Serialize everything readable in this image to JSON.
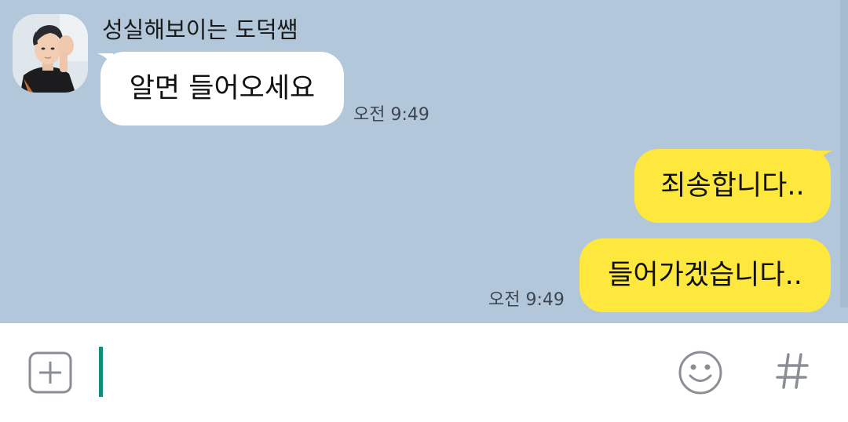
{
  "chat": {
    "sender_name": "성실해보이는 도덕쌤",
    "messages": [
      {
        "direction": "incoming",
        "text": "알면 들어오세요",
        "time": "오전 9:49"
      },
      {
        "direction": "outgoing",
        "text": "죄송합니다..",
        "time": ""
      },
      {
        "direction": "outgoing",
        "text": "들어가겠습니다..",
        "time": "오전 9:49"
      }
    ]
  },
  "composer": {
    "value": "",
    "placeholder": ""
  },
  "icons": {
    "attach": "plus-square-icon",
    "emoji": "smiley-icon",
    "hashtag": "hash-icon"
  },
  "colors": {
    "chat_background": "#b2c7d9",
    "incoming_bubble": "#ffffff",
    "outgoing_bubble": "#fee83d",
    "cursor": "#0f8c7a",
    "icon_gray": "#8a8f96"
  }
}
